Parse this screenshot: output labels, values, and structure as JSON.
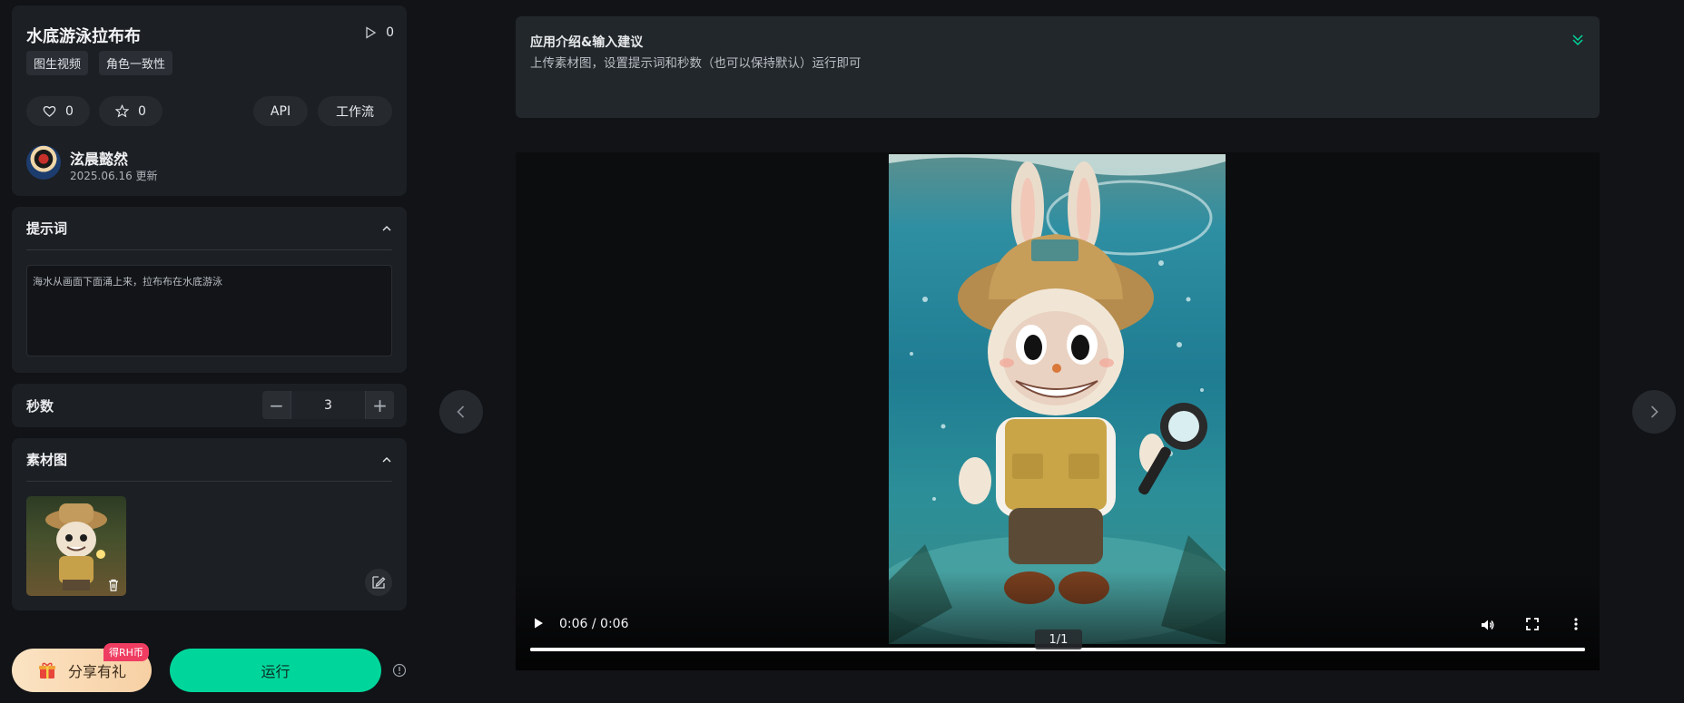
{
  "app": {
    "title": "水底游泳拉布布",
    "run_count": "0",
    "tags": [
      "图生视频",
      "角色一致性"
    ],
    "like_count": "0",
    "favorite_count": "0",
    "api_label": "API",
    "workflow_label": "工作流",
    "author_name": "泫晨懿然",
    "updated": "2025.06.16 更新"
  },
  "prompt": {
    "title": "提示词",
    "text": "海水从画面下面涌上来，拉布布在水底游泳"
  },
  "seconds": {
    "label": "秒数",
    "value": "3",
    "decrement": "−",
    "increment": "+"
  },
  "material": {
    "title": "素材图"
  },
  "bottom": {
    "share_label": "分享有礼",
    "badge": "得RH币",
    "run_label": "运行"
  },
  "intro": {
    "title": "应用介绍&输入建议",
    "text": "上传素材图，设置提示词和秒数（也可以保持默认）运行即可"
  },
  "video": {
    "time": "0:06 / 0:06",
    "page": "1/1",
    "progress": 1.0
  },
  "colors": {
    "accent": "#00d69b",
    "badge": "#ef3d62",
    "panel": "#1c1f23",
    "background": "#111317"
  },
  "icons": [
    "play-icon",
    "heart-icon",
    "star-icon",
    "chevron-up-icon",
    "trash-icon",
    "edit-icon",
    "gift-icon",
    "info-icon",
    "chevrons-down-icon",
    "chevron-left-icon",
    "chevron-right-icon",
    "volume-icon",
    "fullscreen-icon",
    "more-icon"
  ]
}
